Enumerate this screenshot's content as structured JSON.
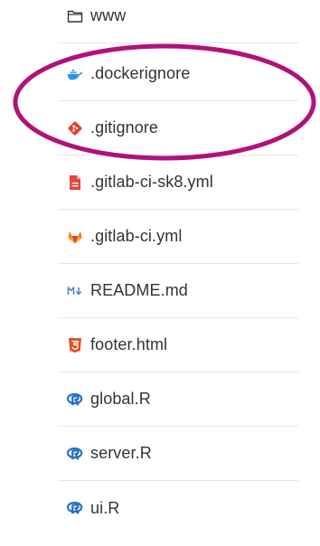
{
  "files": [
    {
      "name": "www",
      "icon": "folder-icon"
    },
    {
      "name": ".dockerignore",
      "icon": "docker-icon"
    },
    {
      "name": ".gitignore",
      "icon": "git-icon"
    },
    {
      "name": ".gitlab-ci-sk8.yml",
      "icon": "yaml-file-icon"
    },
    {
      "name": ".gitlab-ci.yml",
      "icon": "gitlab-icon"
    },
    {
      "name": "README.md",
      "icon": "markdown-icon"
    },
    {
      "name": "footer.html",
      "icon": "html5-icon"
    },
    {
      "name": "global.R",
      "icon": "r-language-icon"
    },
    {
      "name": "server.R",
      "icon": "r-language-icon"
    },
    {
      "name": "ui.R",
      "icon": "r-language-icon"
    }
  ],
  "colors": {
    "highlight_ring": "#b0127a",
    "docker": "#2496ed",
    "git": "#e24329",
    "yaml": "#e8453c",
    "gitlab": "#fc6d26",
    "markdown": "#5a86c8",
    "html5": "#e44d26",
    "r_language": "#276dc3"
  }
}
